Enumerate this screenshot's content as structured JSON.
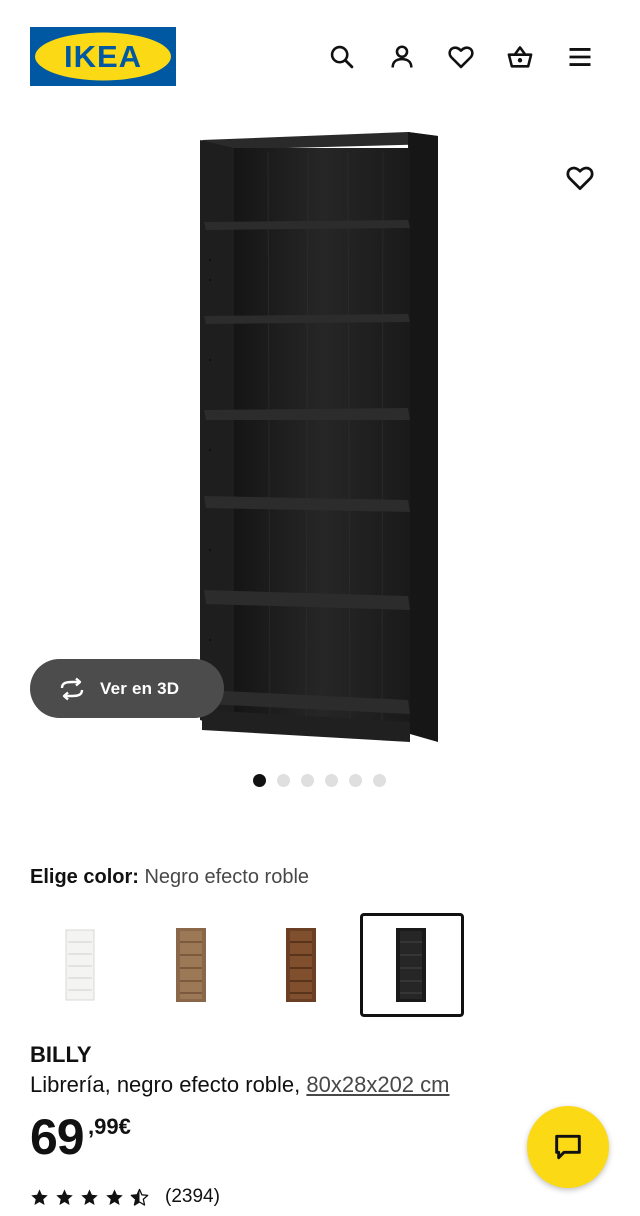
{
  "header": {
    "logo_text": "IKEA",
    "icons": [
      "search-icon",
      "profile-icon",
      "favourites-icon",
      "cart-icon",
      "menu-icon"
    ]
  },
  "media": {
    "button_3d_label": "Ver en 3D",
    "image_count": 6,
    "active_image": 1
  },
  "color_picker": {
    "label": "Elige color:",
    "selected": "Negro efecto roble",
    "options": [
      "blanco",
      "efecto roble marrón",
      "marrón nogal",
      "negro efecto roble"
    ],
    "selected_index": 3
  },
  "product": {
    "name": "BILLY",
    "description": "Librería, negro efecto roble, ",
    "dimensions": "80x28x202 cm",
    "price_integer": "69",
    "price_decimal": ",99€"
  },
  "rating": {
    "stars": 4.5,
    "count": "(2394)"
  },
  "colors": {
    "brand_blue": "#0058a3",
    "brand_yellow": "#fbd914",
    "dark_button": "#4c4c4c"
  }
}
